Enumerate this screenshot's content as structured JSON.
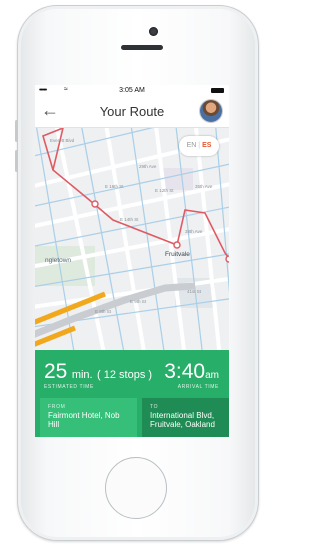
{
  "status_bar": {
    "signal": "•••••",
    "time": "3:05 AM"
  },
  "nav": {
    "title": "Your Route"
  },
  "language": {
    "en": "EN",
    "separator": "|",
    "es": "ES",
    "active": "ES"
  },
  "map": {
    "streets": [
      "Everett Blvd",
      "E 12th St",
      "E 16th St",
      "E 14th St",
      "E 12th St",
      "Ford St",
      "E 8th St",
      "E 9th St",
      "29th Ave",
      "35th Ave",
      "36th Ave",
      "37th Ave",
      "38th Ave",
      "31st Ave",
      "33rd Ave",
      "41st St"
    ],
    "places": [
      "ngletown",
      "Fruitvale"
    ],
    "colors": {
      "route": "#e05a63",
      "highway": "#f2a81d",
      "destination": "#7cc241"
    }
  },
  "trip": {
    "duration_value": "25",
    "duration_unit": "min.",
    "stops": "( 12 stops )",
    "duration_caption": "ESTIMATED TIME",
    "arrival_time": "3:40",
    "arrival_suffix": "am",
    "arrival_caption": "ARRIVAL TIME"
  },
  "from": {
    "label": "FROM",
    "value": "Fairmont Hotel, Nob Hill"
  },
  "to": {
    "label": "TO",
    "value": "International Blvd, Fruitvale, Oakland"
  },
  "colors": {
    "panel": "#27ae69",
    "from_card": "#35bf78",
    "to_card": "#1f8c55"
  }
}
